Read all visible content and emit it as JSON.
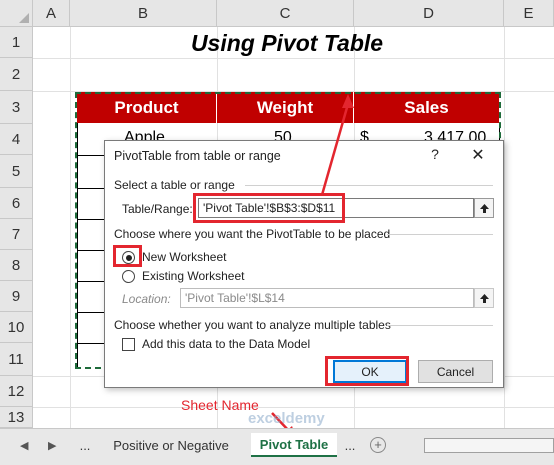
{
  "columns": [
    "A",
    "B",
    "C",
    "D",
    "E"
  ],
  "rows": [
    "1",
    "2",
    "3",
    "4",
    "5",
    "6",
    "7",
    "8",
    "9",
    "10",
    "11",
    "12",
    "13"
  ],
  "sheet_title": "Using Pivot Table",
  "table": {
    "headers": [
      "Product",
      "Weight",
      "Sales"
    ],
    "first_row": {
      "product": "Apple",
      "weight": "50",
      "currency": "$",
      "sales": "3,417.00"
    }
  },
  "dialog": {
    "title": "PivotTable from table or range",
    "help": "?",
    "close": "✕",
    "section_select": "Select a table or range",
    "table_range_label": "Table/Range:",
    "table_range_value": "'Pivot Table'!$B$3:$D$11",
    "section_placement": "Choose where you want the PivotTable to be placed",
    "radio_new": "New Worksheet",
    "radio_existing": "Existing Worksheet",
    "location_label": "Location:",
    "location_value": "'Pivot Table'!$L$14",
    "section_multiple": "Choose whether you want to analyze multiple tables",
    "checkbox_data_model": "Add this data to the Data Model",
    "ok": "OK",
    "cancel": "Cancel"
  },
  "annotation": {
    "sheet_name_label": "Sheet Name"
  },
  "tabs": {
    "prev": "◀",
    "next": "▶",
    "ellipsis_left": "...",
    "sheet_1": "Positive or Negative",
    "sheet_2": "Pivot Table",
    "ellipsis_right": "...",
    "add": "+",
    "watermark": "exceldemy"
  },
  "colors": {
    "header_red": "#c00000",
    "annotation_red": "#e3262f",
    "excel_green": "#1e7145",
    "dialog_focus": "#0078d7"
  },
  "icons": [
    "collapse-dialog-icon",
    "add-sheet-icon",
    "scroll-left-icon",
    "scroll-right-icon",
    "close-icon",
    "help-icon",
    "arrow-icon"
  ]
}
